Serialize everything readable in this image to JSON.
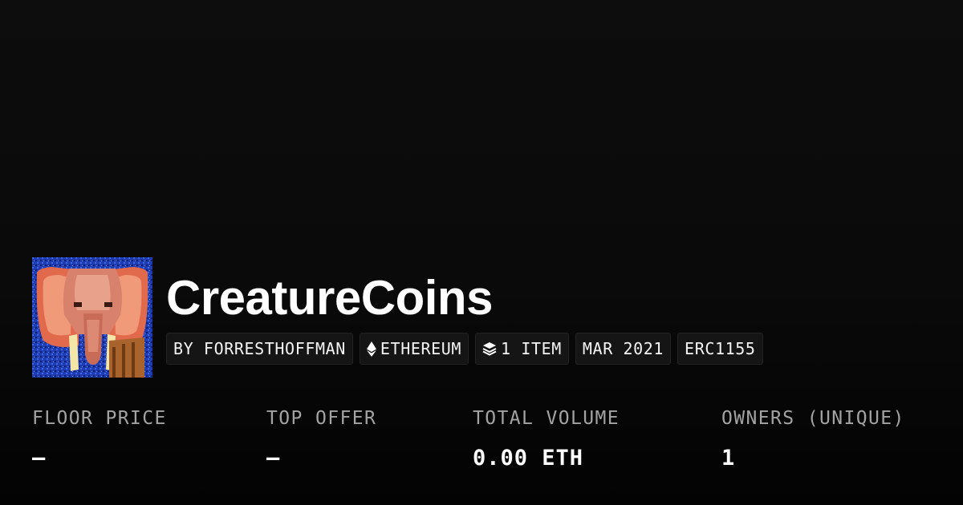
{
  "collection": {
    "name": "CreatureCoins",
    "avatar_icon": "pixel-elephant-avatar"
  },
  "chips": [
    {
      "label": "BY FORRESTHOFFMAN",
      "icon": ""
    },
    {
      "label": "ETHEREUM",
      "icon": "ethereum-icon"
    },
    {
      "label": "1 ITEM",
      "icon": "layers-icon"
    },
    {
      "label": "MAR 2021",
      "icon": ""
    },
    {
      "label": "ERC1155",
      "icon": ""
    }
  ],
  "stats": [
    {
      "label": "FLOOR PRICE",
      "value": "–"
    },
    {
      "label": "TOP OFFER",
      "value": "–"
    },
    {
      "label": "TOTAL VOLUME",
      "value": "0.00 ETH"
    },
    {
      "label": "OWNERS (UNIQUE)",
      "value": "1"
    }
  ],
  "colors": {
    "background": "#0a0a0a",
    "chip_background": "#151515",
    "label_gray": "#a3a3a3",
    "text_white": "#ffffff"
  }
}
